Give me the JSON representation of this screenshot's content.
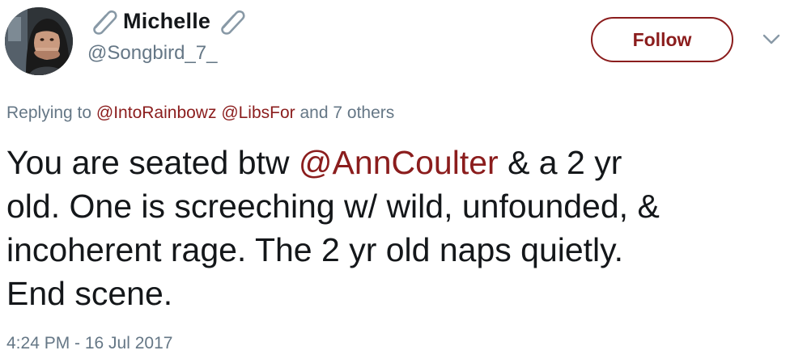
{
  "user": {
    "display_name": "Michelle",
    "handle": "@Songbird_7_",
    "avatar": "avatar-photo",
    "name_decoration_icon": "paperclip-icon"
  },
  "follow_button": {
    "label": "Follow"
  },
  "menu_caret": {
    "icon": "chevron-down-icon"
  },
  "reply_context": {
    "prefix": "Replying to",
    "mentions": [
      "@IntoRainbowz",
      "@LibsFor"
    ],
    "suffix": "and 7 others"
  },
  "tweet": {
    "text_before_mention": "You are seated btw ",
    "mention": "@AnnCoulter",
    "text_after_mention": " & a 2 yr\nold. One is screeching w/ wild, unfounded, &\nincoherent rage. The 2 yr old naps quietly.\nEnd scene.",
    "timestamp": "4:24 PM - 16 Jul 2017"
  },
  "colors": {
    "accent": "#8b1d1d",
    "muted": "#657786",
    "text": "#14171a"
  }
}
